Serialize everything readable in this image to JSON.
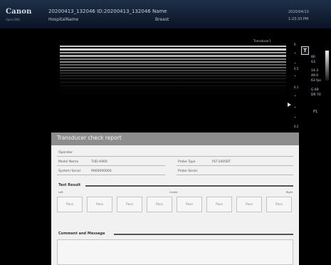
{
  "header": {
    "brand": "Canon",
    "brand_sub": "Aplio i900",
    "patient_line": "20200413_132046 ID:20200413_132046 Name",
    "hospital": "HospitalName",
    "exam": "Breast",
    "date": "2020/04/13",
    "time": "1:23:33 PM"
  },
  "image": {
    "preset": "Transducer1"
  },
  "scale": {
    "labels": [
      "0",
      "0.5",
      "0.1",
      "0.2"
    ]
  },
  "params": {
    "t_marker": "T",
    "values": [
      "80",
      "G1",
      "14.3",
      "49.0",
      "63 fps",
      "G 69",
      "DR 70"
    ],
    "p_label": "P1"
  },
  "report": {
    "title": "Transducer check report",
    "operator_label": "Operator",
    "model_label": "Model Name",
    "model_value": "TUD-A900",
    "serial_label": "System Serial",
    "serial_value": "9900000000",
    "probe_type_label": "Probe Type",
    "probe_type_value": "PLT-1005BT",
    "probe_serial_label": "Probe Serial",
    "test_result_title": "Test Result",
    "pos_left": "Left",
    "pos_center": "Center",
    "pos_right": "Right",
    "results": [
      "Pass",
      "Pass",
      "Pass",
      "Pass",
      "Pass",
      "Pass",
      "Pass",
      "Pass"
    ],
    "comment_title": "Comment and Message"
  },
  "colors": {
    "header_bg": "#0b1424",
    "report_title_bg": "#8d8d8d",
    "report_bg": "#f1f1f1"
  }
}
